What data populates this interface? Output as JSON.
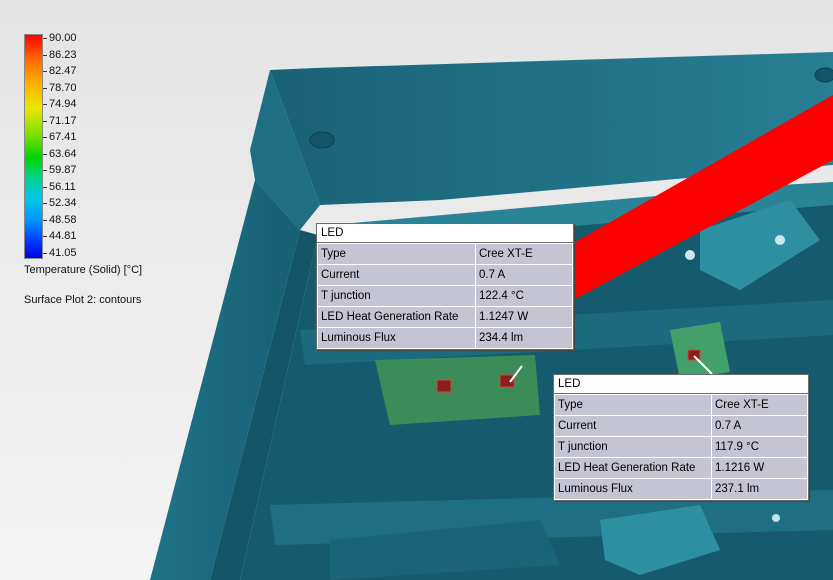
{
  "legend": {
    "ticks": [
      "90.00",
      "86.23",
      "82.47",
      "78.70",
      "74.94",
      "71.17",
      "67.41",
      "63.64",
      "59.87",
      "56.11",
      "52.34",
      "48.58",
      "44.81",
      "41.05"
    ],
    "title": "Temperature (Solid) [°C]",
    "plot_name": "Surface Plot 2: contours"
  },
  "callouts": [
    {
      "header": "LED",
      "rows": [
        {
          "label": "Type",
          "value": "Cree XT-E"
        },
        {
          "label": "Current",
          "value": "0.7 A"
        },
        {
          "label": "T junction",
          "value": "122.4 °C"
        },
        {
          "label": "LED Heat Generation Rate",
          "value": "1.1247 W"
        },
        {
          "label": "Luminous Flux",
          "value": "234.4 lm"
        }
      ]
    },
    {
      "header": "LED",
      "rows": [
        {
          "label": "Type",
          "value": "Cree XT-E"
        },
        {
          "label": "Current",
          "value": "0.7 A"
        },
        {
          "label": "T junction",
          "value": "117.9 °C"
        },
        {
          "label": "LED Heat Generation Rate",
          "value": "1.1216 W"
        },
        {
          "label": "Luminous Flux",
          "value": "237.1 lm"
        }
      ]
    }
  ],
  "colors": {
    "housing": "#1d6c80",
    "housing_light": "#2a8aa0",
    "housing_dark": "#104a5a",
    "pointer": "#ff0000",
    "board": "#3c8c5a",
    "background": "#e9e9e9"
  }
}
